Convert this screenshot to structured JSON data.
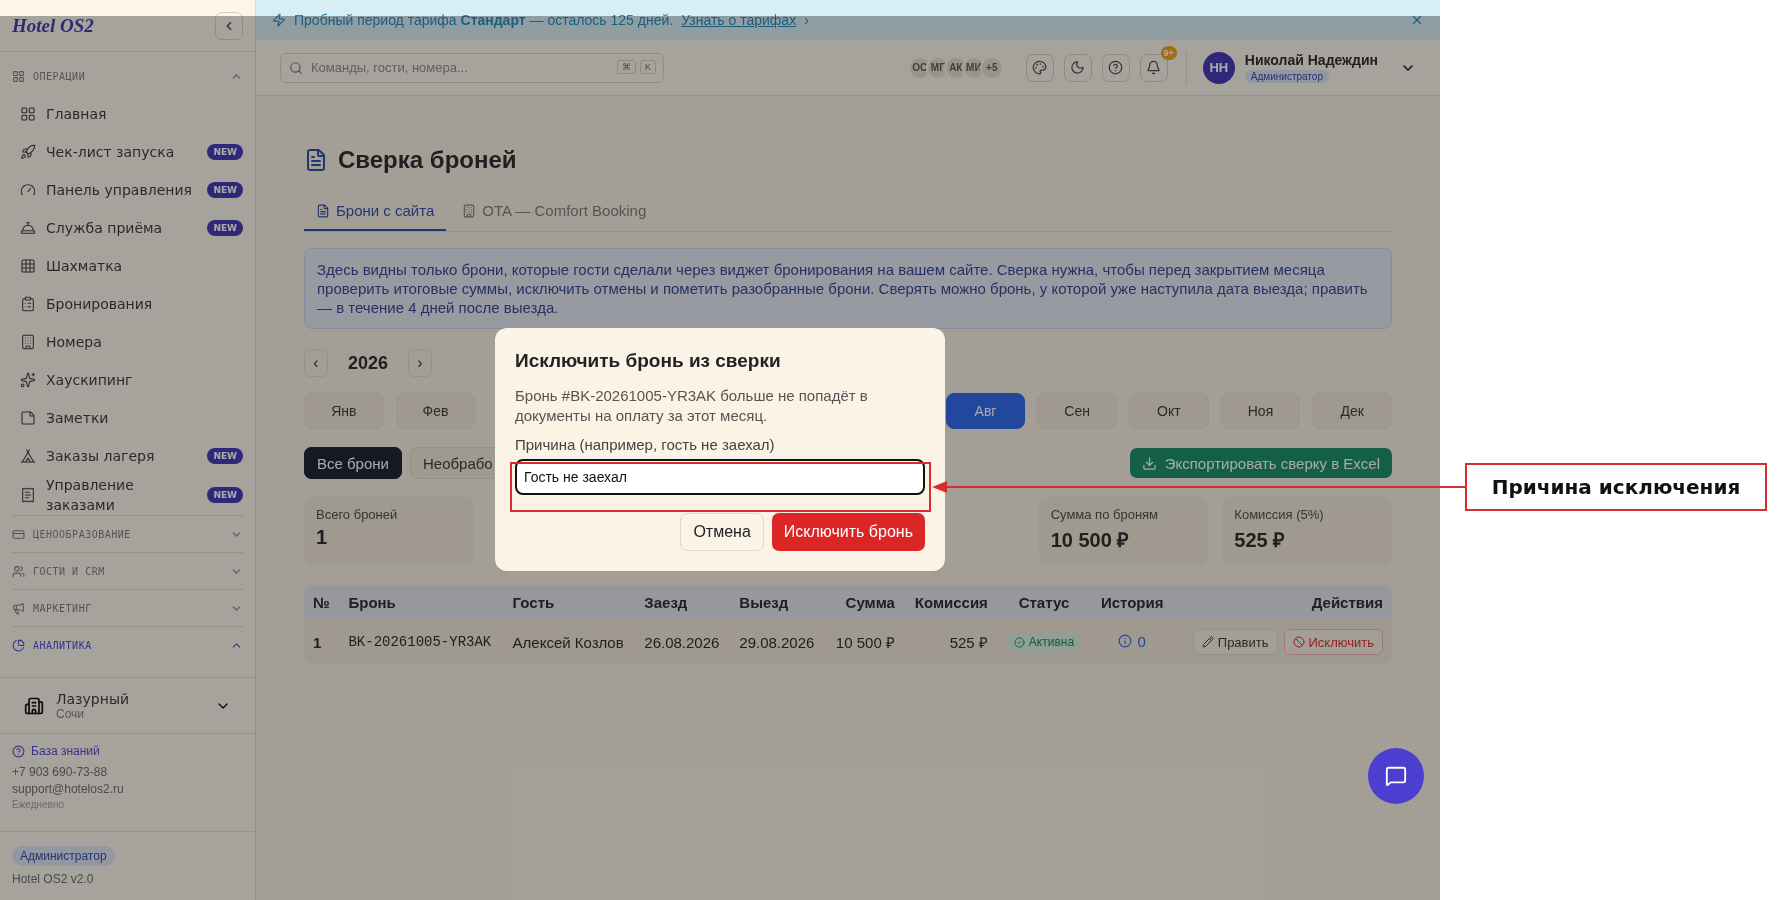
{
  "sidebar": {
    "logo": "Hotel OS2",
    "sections": [
      {
        "title": "ОПЕРАЦИИ",
        "expanded": true,
        "active": false,
        "items": [
          {
            "label": "Главная"
          },
          {
            "label": "Чек-лист запуска",
            "badge": "NEW"
          },
          {
            "label": "Панель управления",
            "badge": "NEW"
          },
          {
            "label": "Служба приёма",
            "badge": "NEW"
          },
          {
            "label": "Шахматка"
          },
          {
            "label": "Бронирования"
          },
          {
            "label": "Номера"
          },
          {
            "label": "Хаускипинг"
          },
          {
            "label": "Заметки"
          },
          {
            "label": "Заказы лагеря",
            "badge": "NEW"
          },
          {
            "label": "Управление заказами",
            "badge": "NEW"
          }
        ]
      },
      {
        "title": "ЦЕНООБРАЗОВАНИЕ",
        "expanded": false,
        "active": false
      },
      {
        "title": "ГОСТИ И CRM",
        "expanded": false,
        "active": false
      },
      {
        "title": "МАРКЕТИНГ",
        "expanded": false,
        "active": false
      },
      {
        "title": "АНАЛИТИКА",
        "expanded": true,
        "active": true
      }
    ],
    "hotel": {
      "name": "Лазурный",
      "city": "Сочи"
    },
    "help_link": "База знаний",
    "phone": "+7 903 690-73-88",
    "email": "support@hotelos2.ru",
    "hours": "Ежедневно",
    "role": "Администратор",
    "version": "Hotel OS2 v2.0"
  },
  "banner": {
    "text": "Пробный период тарифа **Стандарт** — осталось 125 дней.",
    "link": "Узнать о тарифах",
    "link_arrow": "›"
  },
  "topbar": {
    "search_placeholder": "Команды, гости, номера...",
    "keys": [
      "⌘",
      "K"
    ],
    "avatars": [
      "ОС",
      "МГ",
      "АК",
      "МИ",
      "+5"
    ],
    "notifications": "9+",
    "user": {
      "initials": "НН",
      "name": "Николай Надеждин",
      "role": "Администратор"
    }
  },
  "page": {
    "title": "Сверка броней",
    "tabs": [
      {
        "label": "Брони с сайта",
        "selected": true
      },
      {
        "label": "OTA — Comfort Booking",
        "selected": false
      }
    ],
    "info": "Здесь видны только брони, которые гости сделали через виджет бронирования на вашем сайте. Сверка нужна, чтобы перед закрытием месяца проверить итоговые суммы, исключить отмены и пометить разобранные брони. Сверять можно бронь, у которой уже наступила дата выезда; править — в течение 4 дней после выезда.",
    "year": {
      "prev": "‹",
      "value": "2026",
      "next": "›"
    },
    "months_left": [
      {
        "label": "Янв",
        "selected": false
      },
      {
        "label": "Фев",
        "selected": false
      }
    ],
    "months_right": [
      {
        "label": "Авг",
        "selected": true
      },
      {
        "label": "Сен",
        "selected": false
      },
      {
        "label": "Окт",
        "selected": false
      },
      {
        "label": "Ноя",
        "selected": false
      },
      {
        "label": "Дек",
        "selected": false
      }
    ],
    "filters": [
      {
        "label": "Все брони",
        "selected": true
      },
      {
        "label": "Необрабо",
        "selected": false
      }
    ],
    "export_button": "Экспортировать сверку в Excel",
    "stats_left": [
      {
        "label": "Всего броней",
        "value": "1"
      }
    ],
    "stats_right": [
      {
        "label": "Сумма по броням",
        "value": "10 500 ₽"
      },
      {
        "label": "Комиссия (5%)",
        "value": "525 ₽"
      }
    ],
    "table": {
      "columns": [
        "№",
        "Бронь",
        "Гость",
        "Заезд",
        "Выезд",
        "Сумма",
        "Комиссия",
        "Статус",
        "История",
        "Действия"
      ],
      "rows": [
        {
          "n": "1",
          "booking": "BK-20261005-YR3AK",
          "guest": "Алексей Козлов",
          "checkin": "26.08.2026",
          "checkout": "29.08.2026",
          "sum": "10 500 ₽",
          "commission": "525 ₽",
          "status": "Активна",
          "history": "0",
          "actions": [
            "Править",
            "Исключить"
          ]
        }
      ]
    }
  },
  "modal": {
    "title": "Исключить бронь из сверки",
    "text": "Бронь #BK-20261005-YR3AK больше не попадёт в документы на оплату за этот месяц.",
    "field_label": "Причина (например, гость не заехал)",
    "field_value": "Гость не заехал",
    "cancel": "Отмена",
    "confirm": "Исключить бронь"
  },
  "annotation": {
    "label": "Причина исключения"
  }
}
